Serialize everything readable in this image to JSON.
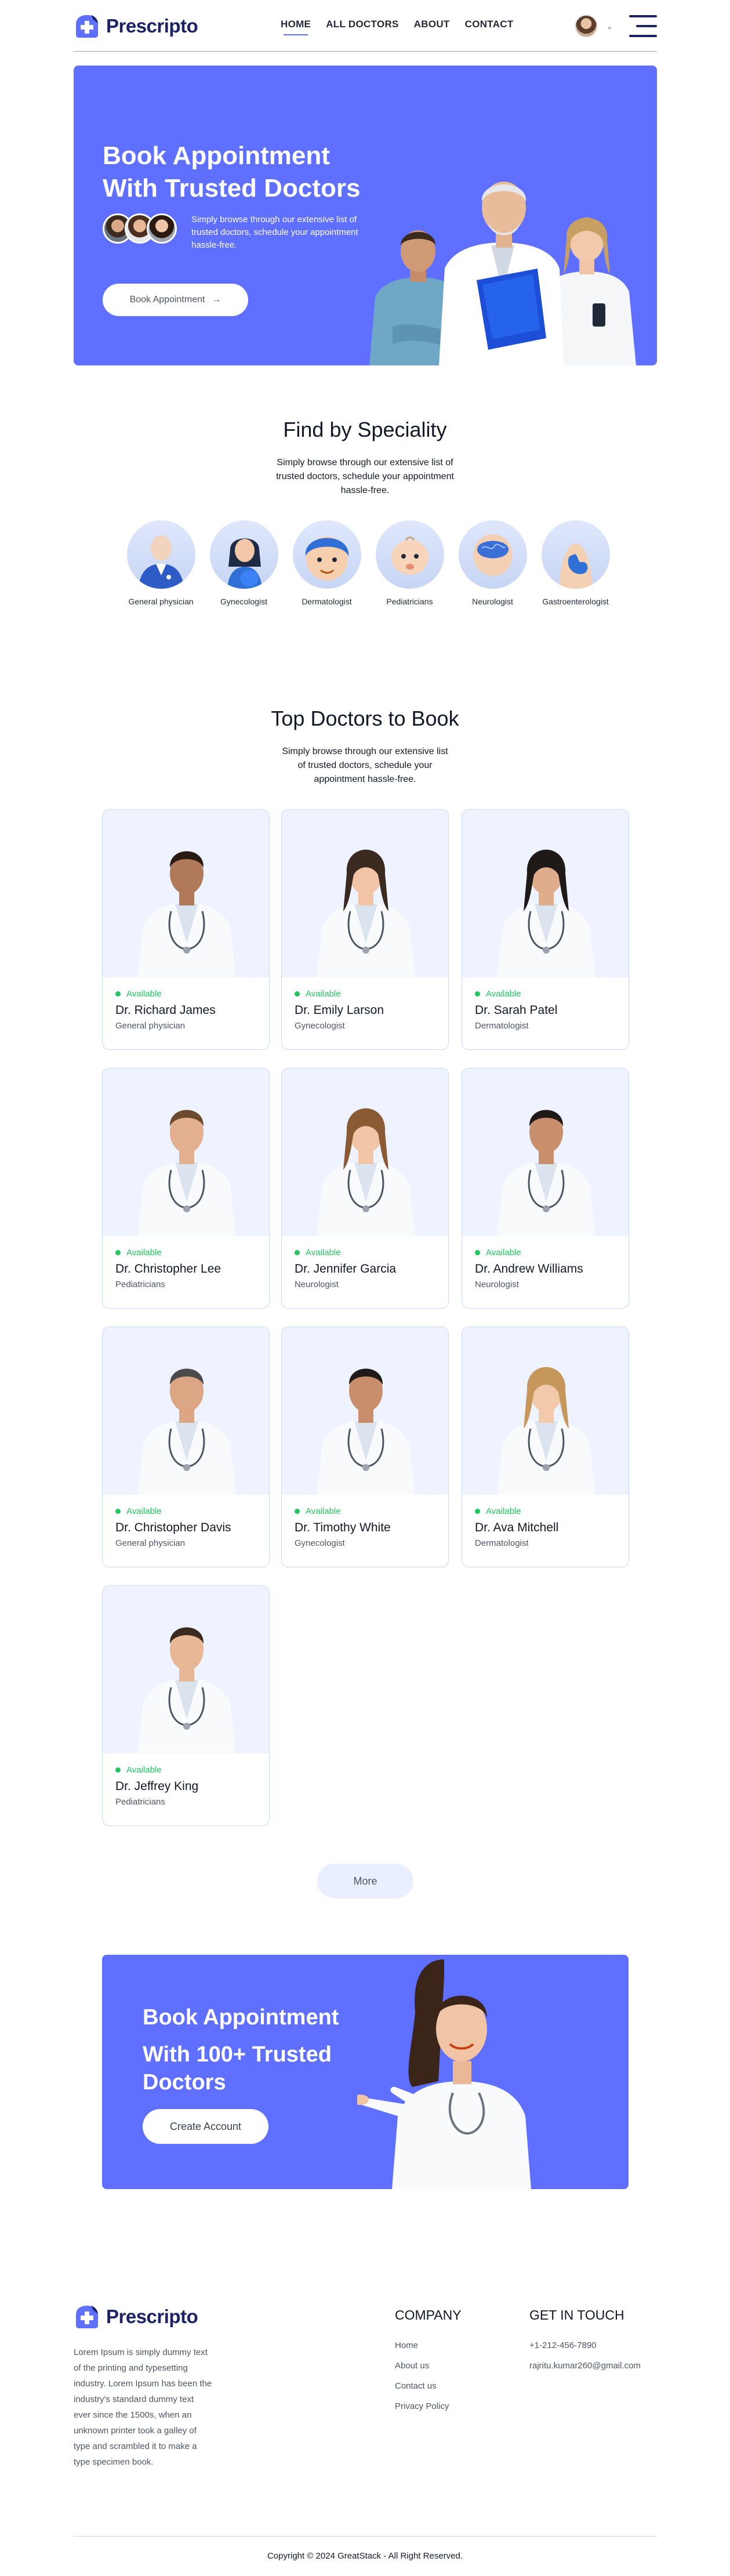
{
  "brand": {
    "name": "Prescripto",
    "color": "#5f6fff",
    "dark": "#1c2467"
  },
  "nav": {
    "items": [
      {
        "label": "HOME",
        "active": true
      },
      {
        "label": "ALL DOCTORS"
      },
      {
        "label": "ABOUT"
      },
      {
        "label": "CONTACT"
      }
    ]
  },
  "hero": {
    "title": "Book Appointment With Trusted Doctors",
    "subtitle": "Simply browse through our extensive list of trusted doctors, schedule your appointment hassle-free.",
    "button_label": "Book Appointment",
    "button_icon": "arrow-right-icon"
  },
  "speciality": {
    "title": "Find by Speciality",
    "subtitle": "Simply browse through our extensive list of trusted doctors, schedule your appointment hassle-free.",
    "items": [
      {
        "label": "General physician"
      },
      {
        "label": "Gynecologist"
      },
      {
        "label": "Dermatologist"
      },
      {
        "label": "Pediatricians"
      },
      {
        "label": "Neurologist"
      },
      {
        "label": "Gastroenterologist"
      }
    ]
  },
  "top_doctors": {
    "title": "Top Doctors to Book",
    "subtitle": "Simply browse through our extensive list of trusted doctors, schedule your appointment hassle-free.",
    "available_label": "Available",
    "doctors": [
      {
        "name": "Dr. Richard James",
        "speciality": "General physician"
      },
      {
        "name": "Dr. Emily Larson",
        "speciality": "Gynecologist"
      },
      {
        "name": "Dr. Sarah Patel",
        "speciality": "Dermatologist"
      },
      {
        "name": "Dr. Christopher Lee",
        "speciality": "Pediatricians"
      },
      {
        "name": "Dr. Jennifer Garcia",
        "speciality": "Neurologist"
      },
      {
        "name": "Dr. Andrew Williams",
        "speciality": "Neurologist"
      },
      {
        "name": "Dr. Christopher Davis",
        "speciality": "General physician"
      },
      {
        "name": "Dr. Timothy White",
        "speciality": "Gynecologist"
      },
      {
        "name": "Dr. Ava Mitchell",
        "speciality": "Dermatologist"
      },
      {
        "name": "Dr. Jeffrey King",
        "speciality": "Pediatricians"
      }
    ],
    "more_label": "More"
  },
  "banner": {
    "line1": "Book Appointment",
    "line2": "With 100+ Trusted Doctors",
    "button_label": "Create Account"
  },
  "footer": {
    "description": "Lorem Ipsum is simply dummy text of the printing and typesetting industry. Lorem Ipsum has been the industry's standard dummy text ever since the 1500s, when an unknown printer took a galley of type and scrambled it to make a type specimen book.",
    "company_title": "COMPANY",
    "company_links": [
      "Home",
      "About us",
      "Contact us",
      "Privacy Policy"
    ],
    "contact_title": "GET IN TOUCH",
    "contact_items": [
      "+1-212-456-7890",
      "rajritu.kumar260@gmail.com"
    ],
    "copyright": "Copyright © 2024 GreatStack - All Right Reserved."
  }
}
